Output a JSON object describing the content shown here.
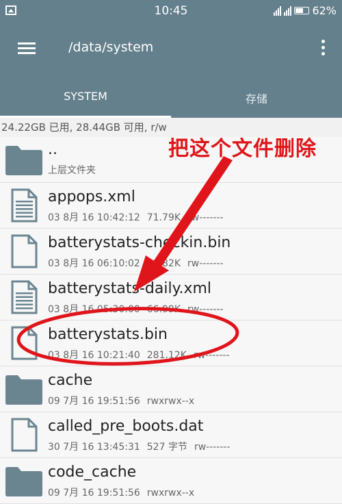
{
  "statusbar": {
    "time": "10:45",
    "battery": "62%"
  },
  "appbar": {
    "path": "/data/system"
  },
  "tabs": [
    {
      "label": "SYSTEM"
    },
    {
      "label": "存储"
    }
  ],
  "storage_info": "24.22GB 已用, 28.44GB 可用, r/w",
  "files": [
    {
      "name": "..",
      "meta": "上层文件夹",
      "type": "folder"
    },
    {
      "name": "appops.xml",
      "date": "03 8月 16 10:42:12",
      "size": "71.79K",
      "perm": "rw-------",
      "type": "doc"
    },
    {
      "name": "batterystats-checkin.bin",
      "date": "03 8月 16 06:10:02",
      "size": "38.82K",
      "perm": "rw-------",
      "type": "file"
    },
    {
      "name": "batterystats-daily.xml",
      "date": "03 8月 16 05:30:00",
      "size": "66.99K",
      "perm": "rw-------",
      "type": "doc"
    },
    {
      "name": "batterystats.bin",
      "date": "03 8月 16 10:21:40",
      "size": "281.12K",
      "perm": "rw-------",
      "type": "file"
    },
    {
      "name": "cache",
      "date": "09 7月 16 19:51:56",
      "size": "",
      "perm": "rwxrwx--x",
      "type": "folder"
    },
    {
      "name": "called_pre_boots.dat",
      "date": "30 7月 16 13:45:31",
      "size": "527 字节",
      "perm": "rw-------",
      "type": "file"
    },
    {
      "name": "code_cache",
      "date": "09 7月 16 19:51:56",
      "size": "",
      "perm": "rwxrwx--x",
      "type": "folder"
    }
  ],
  "annotation": {
    "text": "把这个文件删除",
    "color": "#e0151b"
  },
  "colors": {
    "toolbar": "#64808c",
    "icon": "#6b8590"
  }
}
